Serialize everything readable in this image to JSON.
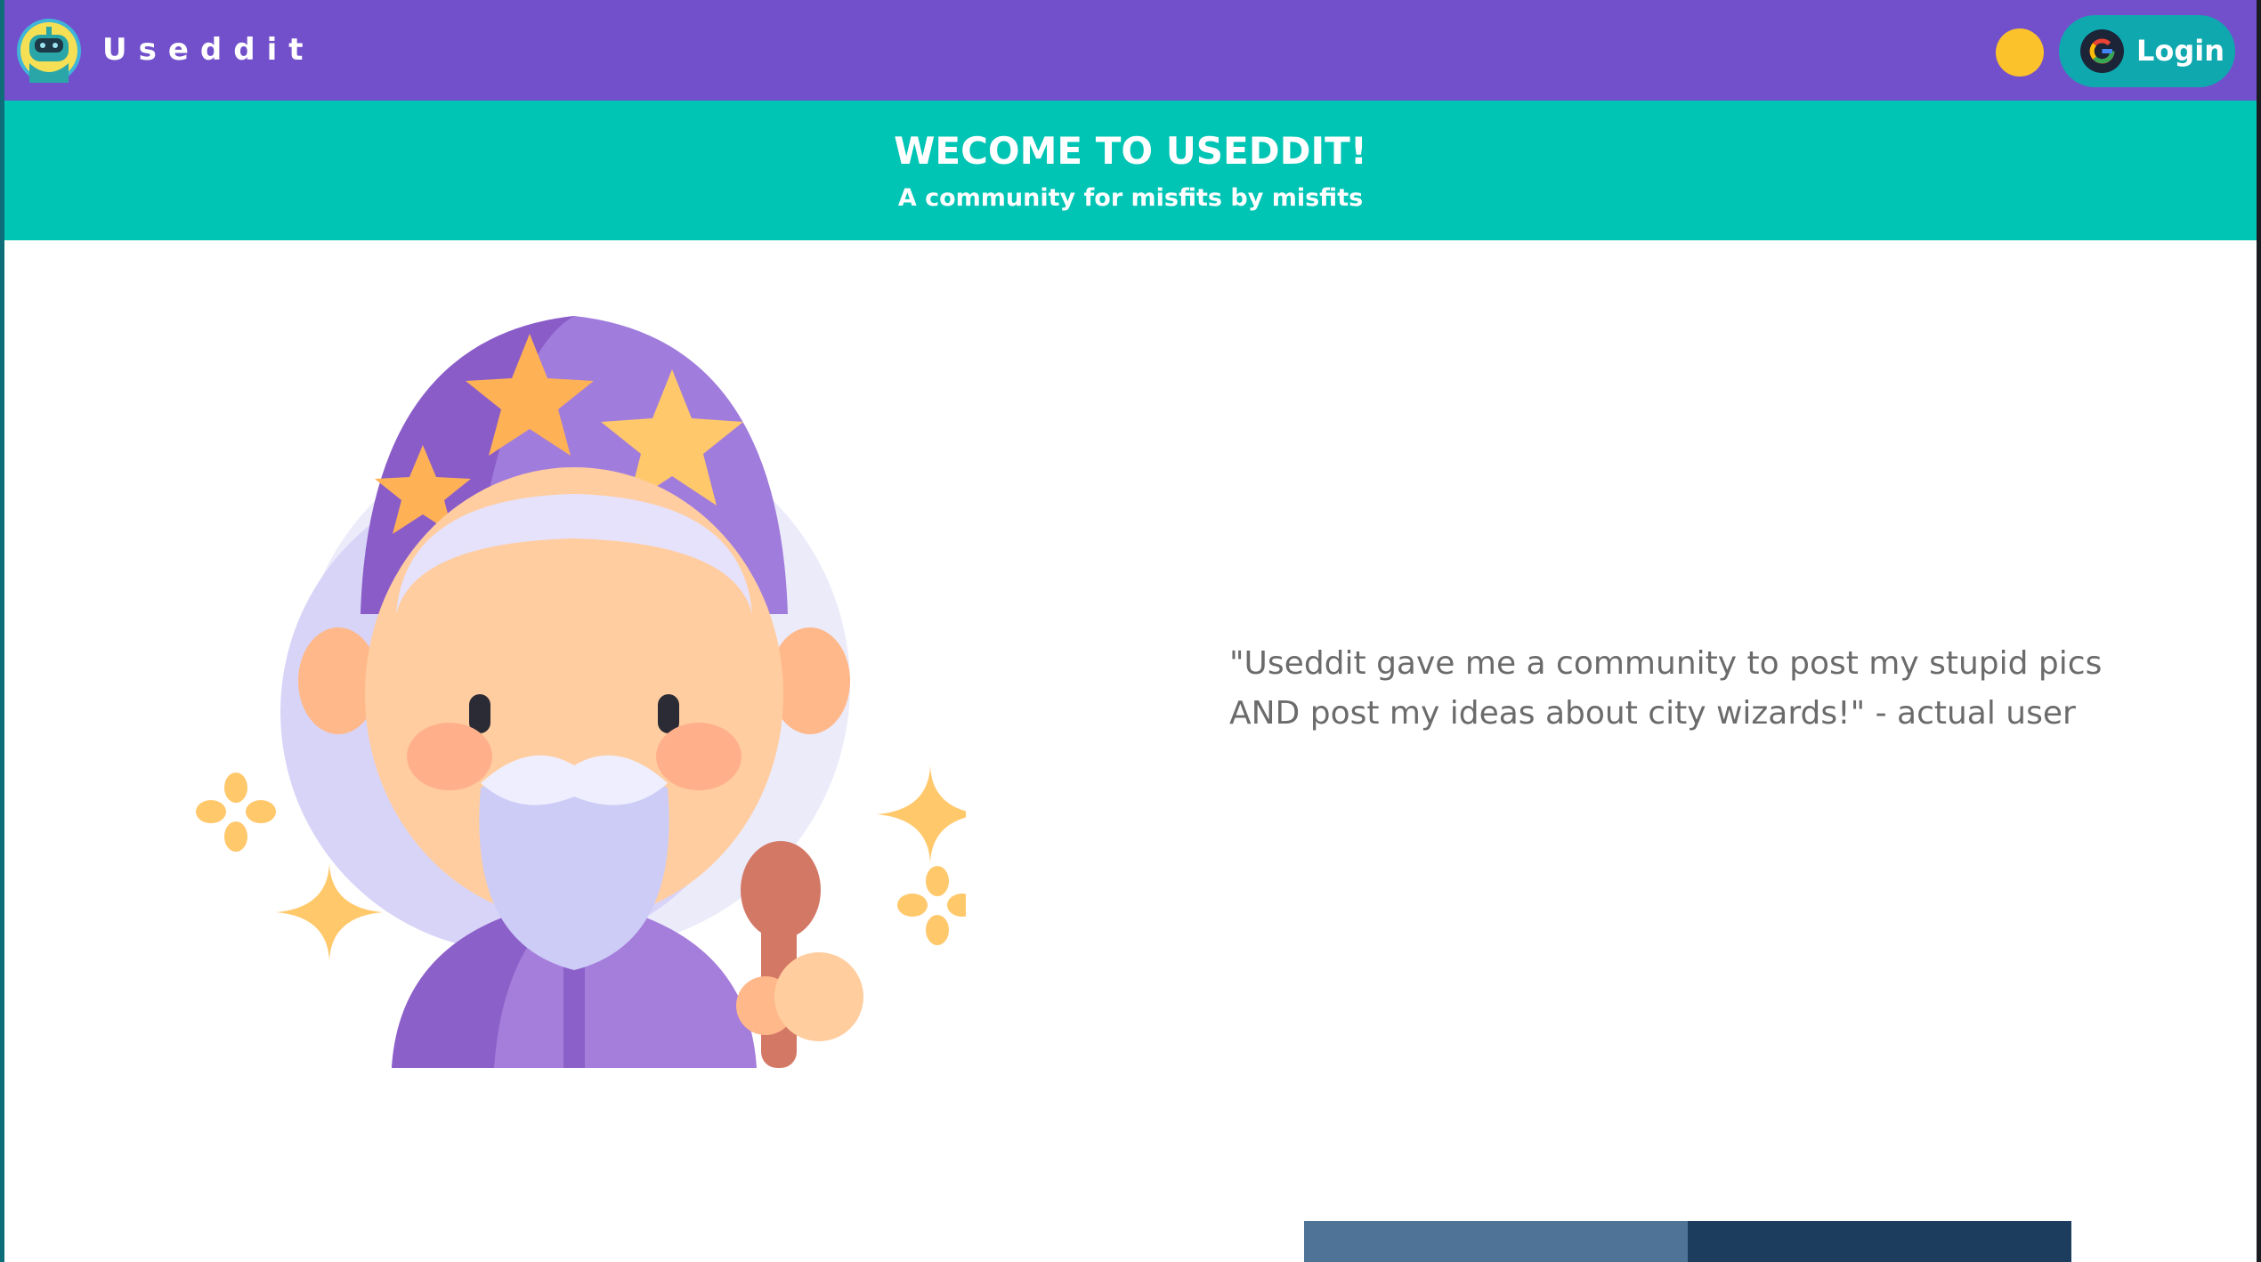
{
  "navbar": {
    "brand": "Useddit",
    "login_label": "Login",
    "logo_icon": "robot-logo-icon",
    "theme_toggle_icon": "sun-icon"
  },
  "banner": {
    "title": "WECOME TO USEDDIT!",
    "subtitle": "A community for misfits by misfits"
  },
  "hero": {
    "illustration": "wizard-illustration",
    "quote_line1": "\"Useddit gave me a community to post my stupid pics",
    "quote_line2": "AND post my ideas about city wizards!\" - actual user"
  },
  "colors": {
    "navbar": "#7350cb",
    "banner": "#00c4b4",
    "login_button": "#0fa8af",
    "theme_toggle": "#fbc22c"
  }
}
